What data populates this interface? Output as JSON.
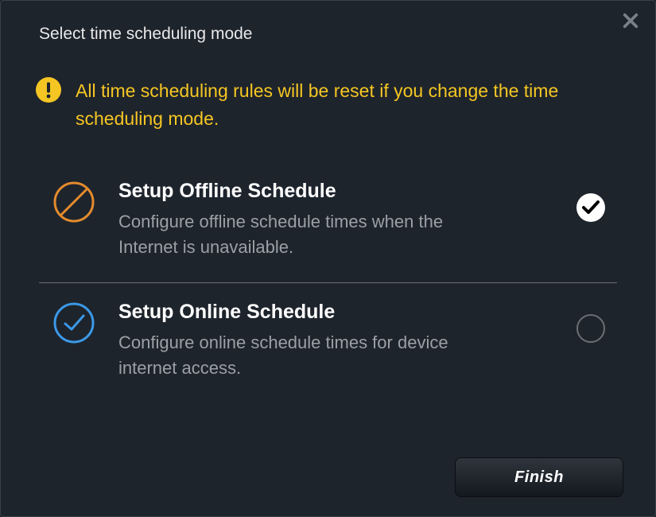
{
  "title": "Select time scheduling mode",
  "warning": {
    "text": "All time scheduling rules will be reset if you change the time scheduling mode."
  },
  "options": [
    {
      "title": "Setup Offline Schedule",
      "description": "Configure offline schedule times when the Internet is unavailable.",
      "selected": true
    },
    {
      "title": "Setup Online Schedule",
      "description": "Configure online schedule times for device internet access.",
      "selected": false
    }
  ],
  "buttons": {
    "finish": "Finish"
  },
  "colors": {
    "accent_yellow": "#f5c623",
    "accent_orange": "#e38b2d",
    "accent_blue": "#3b99e8",
    "background": "#1e242c"
  }
}
